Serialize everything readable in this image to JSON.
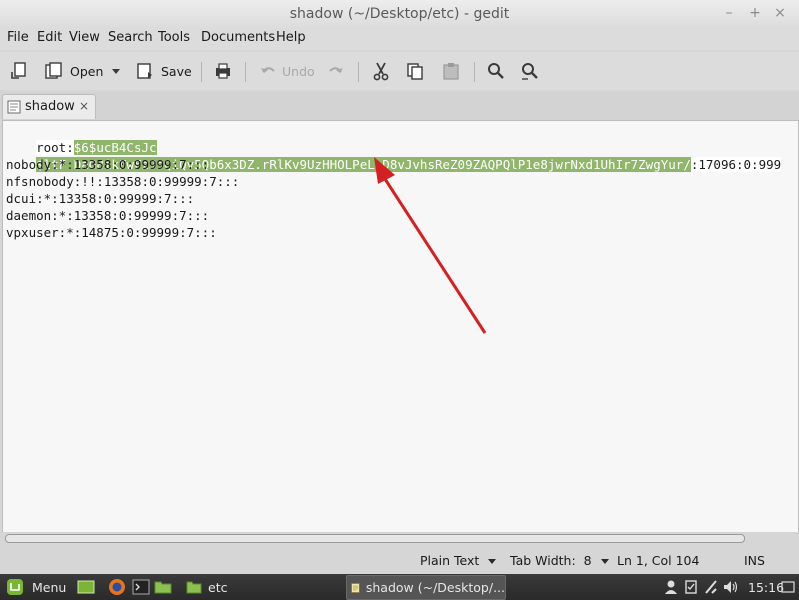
{
  "window": {
    "title": "shadow (~/Desktop/etc) - gedit",
    "minimize": "–",
    "maximize": "+",
    "close": "×"
  },
  "menubar": [
    "File",
    "Edit",
    "View",
    "Search",
    "Tools",
    "Documents",
    "Help"
  ],
  "toolbar": {
    "open_label": "Open",
    "save_label": "Save",
    "undo_label": "Undo"
  },
  "tab": {
    "label": "shadow",
    "close": "×"
  },
  "editor": {
    "lines": [
      {
        "prefix": "root:",
        "selected": "$6$ucB4CsJc",
        "suffix": ""
      },
      {
        "prefix": "",
        "selected": "$ltF.DaGBikFwFzJsQiQv5Qb6x3DZ.rRlKv9UzHHOLPeL.D8vJvhsReZ09ZAQPQlP1e8jwrNxd1UhIr7ZwgYur/",
        "suffix": ":17096:0:999"
      },
      {
        "prefix": "nobody:*:13358:0:99999:7:::",
        "selected": "",
        "suffix": ""
      },
      {
        "prefix": "nfsnobody:!!:13358:0:99999:7:::",
        "selected": "",
        "suffix": ""
      },
      {
        "prefix": "dcui:*:13358:0:99999:7:::",
        "selected": "",
        "suffix": ""
      },
      {
        "prefix": "daemon:*:13358:0:99999:7:::",
        "selected": "",
        "suffix": ""
      },
      {
        "prefix": "vpxuser:*:14875:0:99999:7:::",
        "selected": "",
        "suffix": ""
      }
    ]
  },
  "statusbar": {
    "language": "Plain Text",
    "tab_width": "Tab Width:  8",
    "position": "Ln 1, Col 104",
    "mode": "INS"
  },
  "taskbar": {
    "menu_label": "Menu",
    "folder_label": "etc",
    "window_label": "shadow (~/Desktop/...",
    "clock": "15:16"
  },
  "colors": {
    "selection": "#8fb66a",
    "annotation_arrow": "#d42020"
  }
}
